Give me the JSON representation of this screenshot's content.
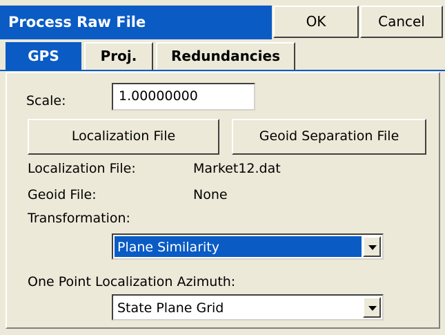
{
  "window": {
    "title": "Process Raw File",
    "ok_label": "OK",
    "cancel_label": "Cancel"
  },
  "tabs": [
    {
      "label": "GPS"
    },
    {
      "label": "Proj."
    },
    {
      "label": "Redundancies"
    }
  ],
  "scale": {
    "label": "Scale:",
    "value": "1.00000000"
  },
  "buttons": {
    "localization_file": "Localization File",
    "geoid_separation_file": "Geoid Separation File"
  },
  "info": {
    "localization_file_label": "Localization File:",
    "localization_file_value": "Market12.dat",
    "geoid_file_label": "Geoid File:",
    "geoid_file_value": "None"
  },
  "transformation": {
    "label": "Transformation:",
    "selected": "Plane Similarity"
  },
  "azimuth": {
    "label": "One Point Localization Azimuth:",
    "selected": "State Plane Grid"
  },
  "colors": {
    "accent": "#0a5bc4",
    "background": "#ece9d8"
  }
}
